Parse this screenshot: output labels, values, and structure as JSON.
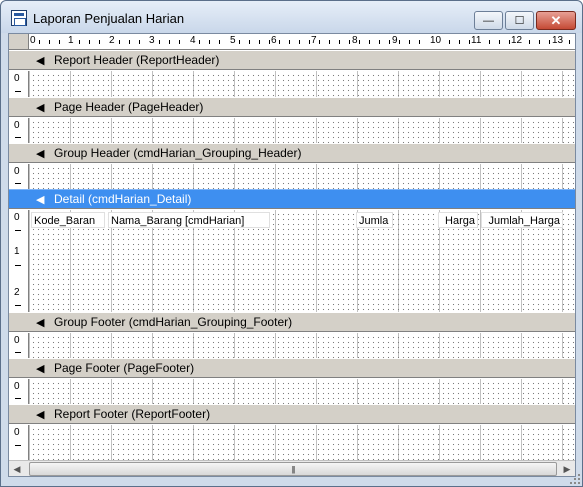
{
  "window": {
    "title": "Laporan Penjualan Harian",
    "min_glyph": "—",
    "max_glyph": "☐",
    "close_glyph": "✕"
  },
  "ruler": {
    "marks": [
      "0",
      "1",
      "2",
      "3",
      "4",
      "5",
      "6",
      "7",
      "8",
      "9",
      "10",
      "11",
      "12",
      "13"
    ]
  },
  "sections": [
    {
      "label": "Report Header (ReportHeader)",
      "selected": false,
      "ruler_marks": [
        "0"
      ]
    },
    {
      "label": "Page Header (PageHeader)",
      "selected": false,
      "ruler_marks": [
        "0"
      ]
    },
    {
      "label": "Group Header (cmdHarian_Grouping_Header)",
      "selected": false,
      "ruler_marks": [
        "0"
      ]
    },
    {
      "label": "Detail (cmdHarian_Detail)",
      "selected": true,
      "ruler_marks": [
        "0",
        "1",
        "2"
      ]
    },
    {
      "label": "Group Footer (cmdHarian_Grouping_Footer)",
      "selected": false,
      "ruler_marks": [
        "0"
      ]
    },
    {
      "label": "Page Footer (PageFooter)",
      "selected": false,
      "ruler_marks": [
        "0"
      ]
    },
    {
      "label": "Report Footer (ReportFooter)",
      "selected": false,
      "ruler_marks": [
        "0"
      ]
    }
  ],
  "detail_fields": [
    {
      "text": "Kode_Baran",
      "align": "left"
    },
    {
      "text": "Nama_Barang [cmdHarian]",
      "align": "left"
    },
    {
      "text": "Jumla",
      "align": "left"
    },
    {
      "text": "Harga",
      "align": "right"
    },
    {
      "text": "Jumlah_Harga",
      "align": "right"
    }
  ],
  "hscroll": {
    "left_arrow": "◀",
    "right_arrow": "▶",
    "thumb_grip": "|||"
  }
}
